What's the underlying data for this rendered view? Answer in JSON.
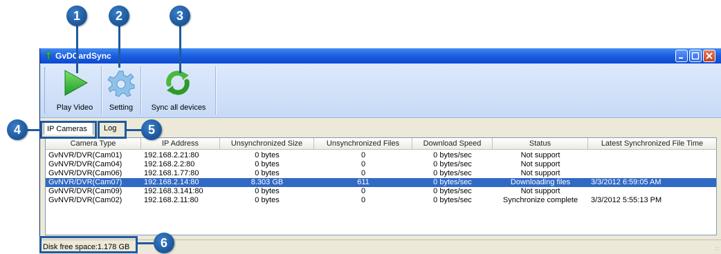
{
  "window": {
    "title": "GvDCardSync"
  },
  "toolbar": {
    "play_label": "Play Video",
    "setting_label": "Setting",
    "sync_label": "Sync all devices"
  },
  "tabs": [
    {
      "label": "IP Cameras",
      "active": true
    },
    {
      "label": "Log",
      "active": false
    }
  ],
  "table": {
    "columns": [
      "Camera Type",
      "IP Address",
      "Unsynchronized Size",
      "Unsynchronized Files",
      "Download Speed",
      "Status",
      "Latest Synchronized File Time"
    ],
    "rows": [
      [
        "GvNVR/DVR(Cam01)",
        "192.168.2.21:80",
        "0 bytes",
        "0",
        "0 bytes/sec",
        "Not support",
        ""
      ],
      [
        "GvNVR/DVR(Cam04)",
        "192.168.2.2:80",
        "0 bytes",
        "0",
        "0 bytes/sec",
        "Not support",
        ""
      ],
      [
        "GvNVR/DVR(Cam06)",
        "192.168.1.77:80",
        "0 bytes",
        "0",
        "0 bytes/sec",
        "Not support",
        ""
      ],
      [
        "GvNVR/DVR(Cam07)",
        "192.168.2.14:80",
        "8.303 GB",
        "611",
        "0 bytes/sec",
        "Downloading files",
        "3/3/2012 6:59:05 AM"
      ],
      [
        "GvNVR/DVR(Cam09)",
        "192.168.3.141:80",
        "0 bytes",
        "0",
        "0 bytes/sec",
        "Not support",
        ""
      ],
      [
        "GvNVR/DVR(Cam02)",
        "192.168.2.11:80",
        "0 bytes",
        "0",
        "0 bytes/sec",
        "Synchronize complete",
        "3/3/2012 5:55:13 PM"
      ]
    ],
    "selected_row": 3
  },
  "status": {
    "disk_free": "Disk free space:1.178 GB"
  },
  "callouts": [
    "1",
    "2",
    "3",
    "4",
    "5",
    "6"
  ],
  "colors": {
    "callout": "#1f5a9e",
    "selection": "#316ac5",
    "titlebar": "#0a4ad4"
  },
  "icons": [
    "app-icon",
    "play-icon",
    "gear-icon",
    "sync-icon",
    "minimize-icon",
    "maximize-icon",
    "close-icon"
  ]
}
